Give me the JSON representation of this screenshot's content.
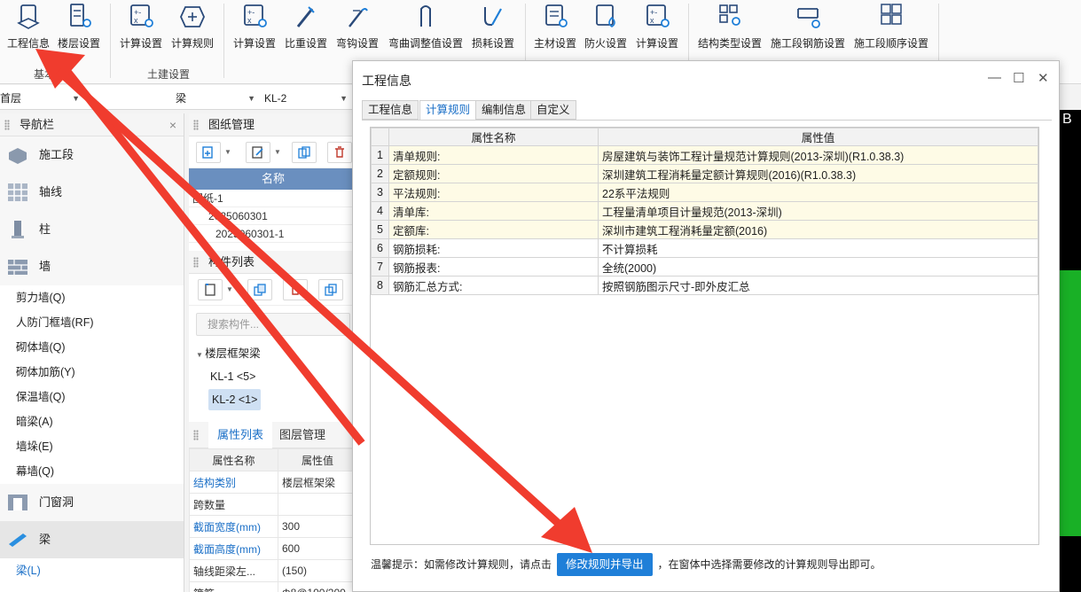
{
  "ribbon": {
    "buttons": [
      {
        "label": "工程信息",
        "icon": "project-info-icon"
      },
      {
        "label": "楼层设置",
        "icon": "floor-settings-icon"
      },
      {
        "label": "计算设置",
        "icon": "calc-settings-icon"
      },
      {
        "label": "计算规则",
        "icon": "calc-rules-icon"
      },
      {
        "label": "计算设置",
        "icon": "calc-settings-icon"
      },
      {
        "label": "比重设置",
        "icon": "density-settings-icon"
      },
      {
        "label": "弯钩设置",
        "icon": "hook-settings-icon"
      },
      {
        "label": "弯曲调整值设置",
        "icon": "bend-adjust-icon"
      },
      {
        "label": "损耗设置",
        "icon": "loss-settings-icon"
      },
      {
        "label": "主材设置",
        "icon": "main-material-icon"
      },
      {
        "label": "防火设置",
        "icon": "fire-settings-icon"
      },
      {
        "label": "计算设置",
        "icon": "calc-settings-icon"
      },
      {
        "label": "结构类型设置",
        "icon": "structure-type-icon"
      },
      {
        "label": "施工段钢筋设置",
        "icon": "section-rebar-icon"
      },
      {
        "label": "施工段顺序设置",
        "icon": "section-order-icon"
      }
    ],
    "groups": [
      "基本",
      "土建设置"
    ]
  },
  "dropdowns": [
    "首层",
    "梁",
    "KL-2"
  ],
  "nav": {
    "title": "导航栏",
    "categories": [
      "施工段",
      "轴线",
      "柱",
      "墙",
      "门窗洞",
      "梁"
    ],
    "wall_items": [
      "剪力墙(Q)",
      "人防门框墙(RF)",
      "砌体墙(Q)",
      "砌体加筋(Y)",
      "保温墙(Q)",
      "暗梁(A)",
      "墙垛(E)",
      "幕墙(Q)"
    ],
    "beam_items": [
      "梁(L)"
    ]
  },
  "drawing": {
    "title": "图纸管理",
    "column": "名称",
    "rows": [
      "图纸-1",
      "2025060301",
      "2025060301-1"
    ]
  },
  "components": {
    "title": "构件列表",
    "search_placeholder": "搜索构件...",
    "group": "楼层框架梁",
    "items": [
      "KL-1 <5>",
      "KL-2 <1>"
    ]
  },
  "props": {
    "tabs": [
      "属性列表",
      "图层管理"
    ],
    "headers": [
      "属性名称",
      "属性值"
    ],
    "rows": [
      {
        "name": "结构类别",
        "value": "楼层框架梁",
        "blue": true
      },
      {
        "name": "跨数量",
        "value": "",
        "blue": false
      },
      {
        "name": "截面宽度(mm)",
        "value": "300",
        "blue": true
      },
      {
        "name": "截面高度(mm)",
        "value": "600",
        "blue": true
      },
      {
        "name": "轴线距梁左...",
        "value": "(150)",
        "blue": false
      },
      {
        "name": "箍筋",
        "value": "Φ8@100/200",
        "blue": false
      }
    ]
  },
  "dialog": {
    "title": "工程信息",
    "tabs": [
      "工程信息",
      "计算规则",
      "编制信息",
      "自定义"
    ],
    "active_tab": "计算规则",
    "headers": [
      "属性名称",
      "属性值"
    ],
    "rows": [
      {
        "num": "1",
        "name": "清单规则:",
        "value": "房屋建筑与装饰工程计量规范计算规则(2013-深圳)(R1.0.38.3)",
        "yellow": true
      },
      {
        "num": "2",
        "name": "定额规则:",
        "value": "深圳建筑工程消耗量定额计算规则(2016)(R1.0.38.3)",
        "yellow": true
      },
      {
        "num": "3",
        "name": "平法规则:",
        "value": "22系平法规则",
        "yellow": true
      },
      {
        "num": "4",
        "name": "清单库:",
        "value": "工程量清单项目计量规范(2013-深圳)",
        "yellow": true
      },
      {
        "num": "5",
        "name": "定额库:",
        "value": "深圳市建筑工程消耗量定额(2016)",
        "yellow": true
      },
      {
        "num": "6",
        "name": "钢筋损耗:",
        "value": "不计算损耗",
        "yellow": false
      },
      {
        "num": "7",
        "name": "钢筋报表:",
        "value": "全统(2000)",
        "yellow": false
      },
      {
        "num": "8",
        "name": "钢筋汇总方式:",
        "value": "按照钢筋图示尺寸-即外皮汇总",
        "yellow": false
      }
    ],
    "tip_prefix": "温馨提示：如需修改计算规则，请点击",
    "tip_button": "修改规则并导出",
    "tip_suffix": "，在窗体中选择需要修改的计算规则导出即可。"
  },
  "canvas_label": "B",
  "colors": {
    "accent": "#1f7fd8",
    "arrow": "#f03c2e",
    "canvas_green": "#19b026"
  }
}
